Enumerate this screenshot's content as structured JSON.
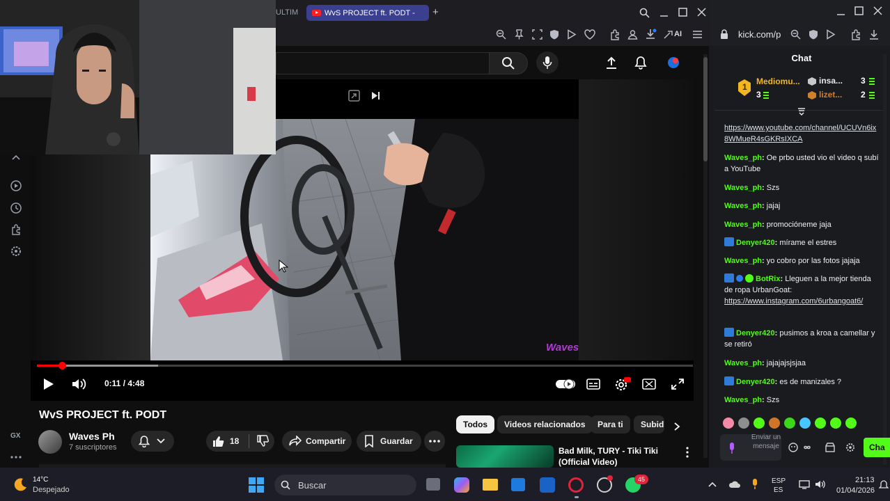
{
  "browser": {
    "tab_partial": "ULTIM",
    "active_tab_title": "WvS PROJECT ft. PODT -",
    "new_tab_symbol": "+",
    "ai_label": "AI"
  },
  "player": {
    "current_time": "0:11",
    "duration": "4:48",
    "time_display": "0:11 / 4:48",
    "progress_fraction": 0.038,
    "watermark": "Waves"
  },
  "video": {
    "title": "WvS PROJECT ft. PODT",
    "channel_name": "Waves Ph",
    "subscribers": "7 suscriptores",
    "like_count": "18",
    "share_label": "Compartir",
    "save_label": "Guardar"
  },
  "left_nav": {
    "label": "GX"
  },
  "chips": [
    "Todos",
    "Videos relacionados",
    "Para ti",
    "Subid"
  ],
  "recommendation": {
    "title": "Bad Milk, TURY - Tiki Tiki (Official Video)"
  },
  "chat_window": {
    "address": "kick.com/p",
    "title": "Chat",
    "leaderboard": [
      {
        "rank": "1",
        "name": "Mediomu...",
        "count": "3"
      },
      {
        "name": "insa...",
        "count": "3"
      },
      {
        "name": "lizet...",
        "count": "2"
      }
    ],
    "messages": [
      {
        "user": "",
        "text": "",
        "link": "https://www.youtube.com/channel/UCUVn6ix8WMueR4sGKRsIXCA"
      },
      {
        "user": "Waves_ph",
        "text": "Oe prbo usted vio el video q subí a YouTube",
        "link": ""
      },
      {
        "user": "Waves_ph",
        "text": "Szs",
        "link": ""
      },
      {
        "user": "Waves_ph",
        "text": "jajaj",
        "link": ""
      },
      {
        "user": "Waves_ph",
        "text": "promocióneme jaja",
        "link": ""
      },
      {
        "user": "Denyer420",
        "text": "mírame el estres",
        "link": ""
      },
      {
        "user": "Waves_ph",
        "text": "yo cobro por las fotos jajaja",
        "link": ""
      },
      {
        "user": "BotRix",
        "text": "Lleguen a la mejor tienda de ropa UrbanGoat:",
        "link": "https://www.instagram.com/6urbangoat6/"
      },
      {
        "user": "Denyer420",
        "text": "pusimos a kroa a camellar y se retiró",
        "link": ""
      },
      {
        "user": "Waves_ph",
        "text": "jajajajsjsjaa",
        "link": ""
      },
      {
        "user": "Denyer420",
        "text": "es de manizales ?",
        "link": ""
      },
      {
        "user": "Waves_ph",
        "text": "Szs",
        "link": ""
      }
    ],
    "input_placeholder": "Enviar un mensaje",
    "send_label": "Cha"
  },
  "taskbar": {
    "temperature": "14°C",
    "weather": "Despejado",
    "search_label": "Buscar",
    "notification_badge": "45",
    "language_line1": "ESP",
    "language_line2": "ES",
    "time": "21:13",
    "date": "01/04/2026"
  },
  "colors": {
    "youtube_red": "#ff0000",
    "kick_green": "#53fc18",
    "mod_blue": "#2f7cf6",
    "tab_active": "#3b3f8f"
  }
}
